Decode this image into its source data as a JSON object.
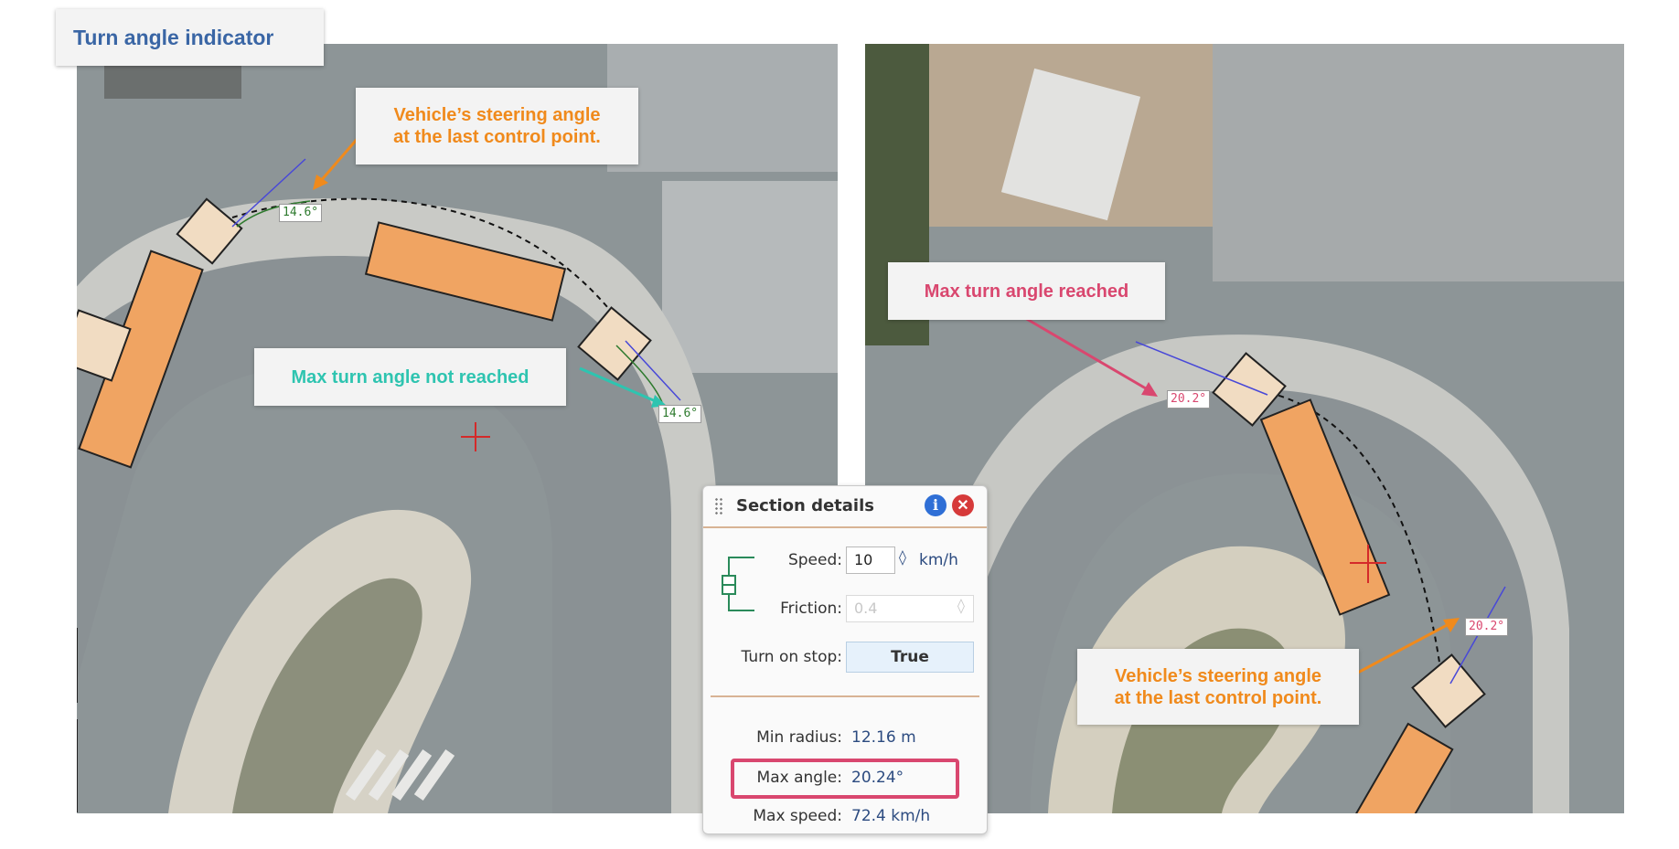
{
  "title": "Turn angle indicator",
  "left_map": {
    "callout_steering": [
      "Vehicle’s steering angle",
      "at the last control point."
    ],
    "callout_not_reached": "Max turn angle not reached",
    "angle_tag_1": "14.6°",
    "angle_tag_2": "14.6°"
  },
  "right_map": {
    "callout_max_reached": "Max turn angle reached",
    "callout_steering": [
      "Vehicle’s steering angle",
      "at the last control point."
    ],
    "angle_tag_1": "20.2°",
    "angle_tag_2": "20.2°"
  },
  "panel": {
    "title": "Section details",
    "info_icon": "info-icon",
    "close_icon": "close-icon",
    "speed_label": "Speed:",
    "speed_value": "10",
    "speed_unit": "km/h",
    "friction_label": "Friction:",
    "friction_placeholder": "0.4",
    "turn_on_stop_label": "Turn on stop:",
    "turn_on_stop_value": "True",
    "min_radius_label": "Min radius:",
    "min_radius_value": "12.16 m",
    "max_angle_label": "Max angle:",
    "max_angle_value": "20.24°",
    "max_speed_label": "Max speed:",
    "max_speed_value": "72.4 km/h"
  },
  "colors": {
    "title_blue": "#3a66a5",
    "orange": "#f08a1c",
    "teal": "#2ec4b0",
    "pink": "#d9476f",
    "highlight_border": "#d9476f"
  }
}
